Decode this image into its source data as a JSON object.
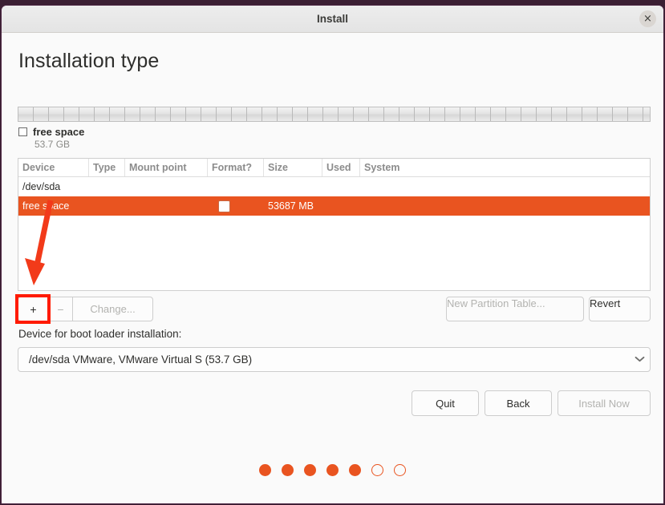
{
  "window": {
    "title": "Install",
    "close_icon": "close-icon",
    "close_glyph": "×"
  },
  "page": {
    "heading": "Installation type"
  },
  "disk_legend": {
    "swatch_label": "free space",
    "swatch_size": "53.7 GB"
  },
  "partition_table": {
    "columns": [
      "Device",
      "Type",
      "Mount point",
      "Format?",
      "Size",
      "Used",
      "System"
    ],
    "rows": [
      {
        "device": "/dev/sda",
        "type": "",
        "mount_point": "",
        "format": "",
        "size": "",
        "used": "",
        "system": "",
        "selected": false,
        "has_checkbox": false
      },
      {
        "device": "free space",
        "type": "",
        "mount_point": "",
        "format": "",
        "size": "53687 MB",
        "used": "",
        "system": "",
        "selected": true,
        "has_checkbox": true,
        "checked": false
      }
    ]
  },
  "edit_controls": {
    "add_label": "+",
    "remove_label": "−",
    "change_label": "Change...",
    "new_partition_table_label": "New Partition Table...",
    "revert_label": "Revert"
  },
  "bootloader": {
    "label": "Device for boot loader installation:",
    "selected_value": "/dev/sda VMware, VMware Virtual S (53.7 GB)",
    "chevron_icon": "chevron-down-icon",
    "chevron_glyph": "⌄"
  },
  "actions": {
    "quit_label": "Quit",
    "back_label": "Back",
    "install_label": "Install Now"
  },
  "progress": {
    "total_dots": 7,
    "filled_dots": 5,
    "states": [
      "filled",
      "filled",
      "filled",
      "filled",
      "filled",
      "empty",
      "empty"
    ]
  },
  "annotations": {
    "highlight_target": "add-partition-button",
    "arrow_color": "#f23a1a",
    "box_color": "#ff1a00"
  },
  "colors": {
    "accent_orange": "#e95420",
    "window_bg": "#fafafa",
    "desktop_bg": "#3b1f33"
  }
}
